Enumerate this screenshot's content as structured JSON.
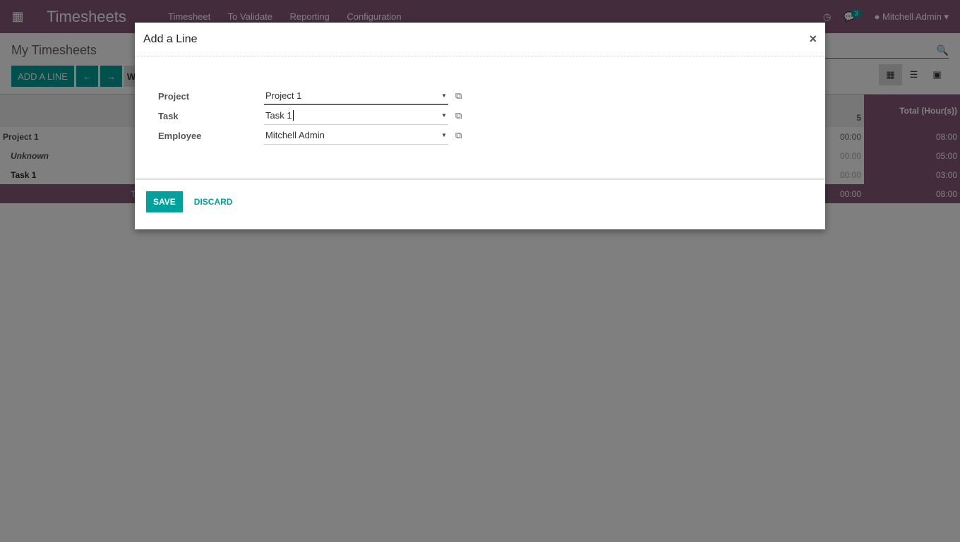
{
  "navbar": {
    "app_title": "Timesheets",
    "menu": [
      "Timesheet",
      "To Validate",
      "Reporting",
      "Configuration"
    ],
    "message_count": "3",
    "user": "Mitchell Admin"
  },
  "control": {
    "page_title": "My Timesheets",
    "add_line": "ADD A LINE",
    "week_label": "W"
  },
  "grid": {
    "header_total": "Total (Hour(s))",
    "header_day_partial": "5",
    "rows": [
      {
        "label": "Project 1",
        "day": "00:00",
        "total": "08:00"
      },
      {
        "label": "Unknown",
        "day": "00:00",
        "total": "05:00"
      },
      {
        "label": "Task 1",
        "day": "00:00",
        "total": "03:00"
      }
    ],
    "footer": {
      "label": "T",
      "day": "00:00",
      "total": "08:00"
    }
  },
  "dialog": {
    "title": "Add a Line",
    "fields": [
      {
        "label": "Project",
        "value": "Project 1"
      },
      {
        "label": "Task",
        "value": "Task 1"
      },
      {
        "label": "Employee",
        "value": "Mitchell Admin"
      }
    ],
    "save": "SAVE",
    "discard": "DISCARD"
  },
  "colors": {
    "brand": "#875A7B",
    "accent": "#00A09D"
  }
}
